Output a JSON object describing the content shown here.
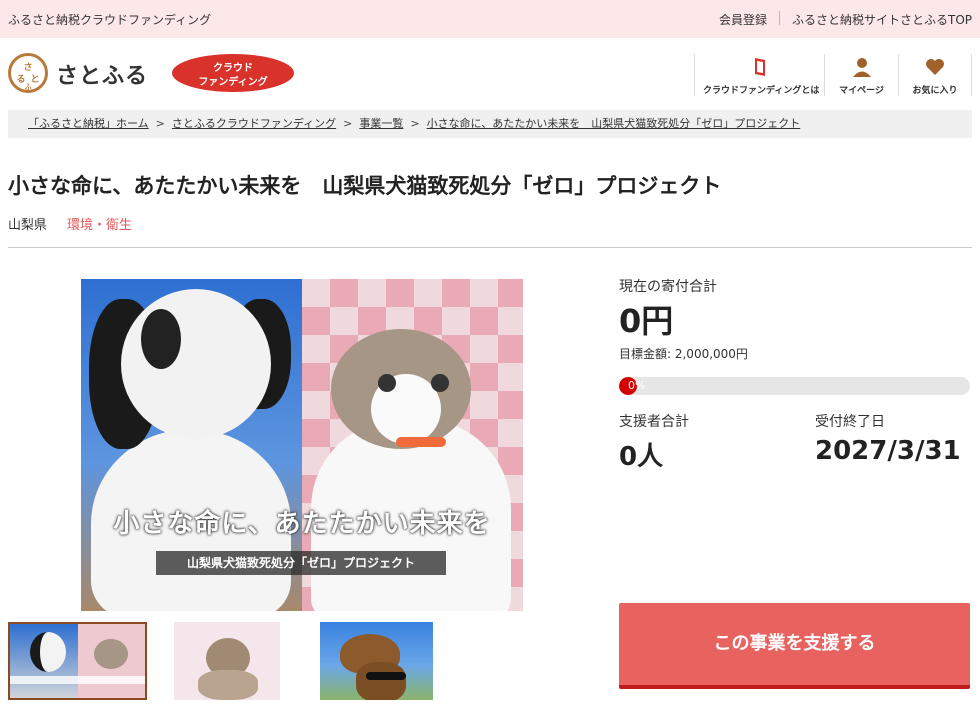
{
  "topbar": {
    "site_name": "ふるさと納税クラウドファンディング",
    "member_login": "会員登録",
    "top_link": "ふるさと納税サイトさとふるTOP"
  },
  "header": {
    "logo_text": "さとふる",
    "badge_line1": "クラウド",
    "badge_line2": "ファンディング",
    "nav": [
      {
        "label": "クラウドファンディングとは",
        "icon": "book-icon"
      },
      {
        "label": "マイページ",
        "icon": "user-icon"
      },
      {
        "label": "お気に入り",
        "icon": "heart-icon"
      }
    ]
  },
  "breadcrumb": [
    "「ふるさと納税」ホーム",
    "さとふるクラウドファンディング",
    "事業一覧",
    "小さな命に、あたたかい未来を　山梨県犬猫致死処分「ゼロ」プロジェクト"
  ],
  "project": {
    "title": "小さな命に、あたたかい未来を　山梨県犬猫致死処分「ゼロ」プロジェクト",
    "prefecture": "山梨県",
    "category": "環境・衛生",
    "hero_headline": "小さな命に、あたたかい未来を",
    "hero_subtitle": "山梨県犬猫致死処分「ゼロ」プロジェクト"
  },
  "stats": {
    "total_label": "現在の寄付合計",
    "total_value": "0円",
    "goal_text": "目標金額: 2,000,000円",
    "progress_text": "0%",
    "progress_fraction": 0.0,
    "supporters_label": "支援者合計",
    "supporters_value": "0人",
    "deadline_label": "受付終了日",
    "deadline_value": "2027/3/31"
  },
  "cta": {
    "support_label": "この事業を支援する"
  },
  "colors": {
    "topbar_bg": "#fce8e8",
    "accent_red": "#d9322a",
    "category_red": "#e05a5a",
    "button_bg": "#e8625f",
    "logo_brown": "#b87a3a"
  }
}
